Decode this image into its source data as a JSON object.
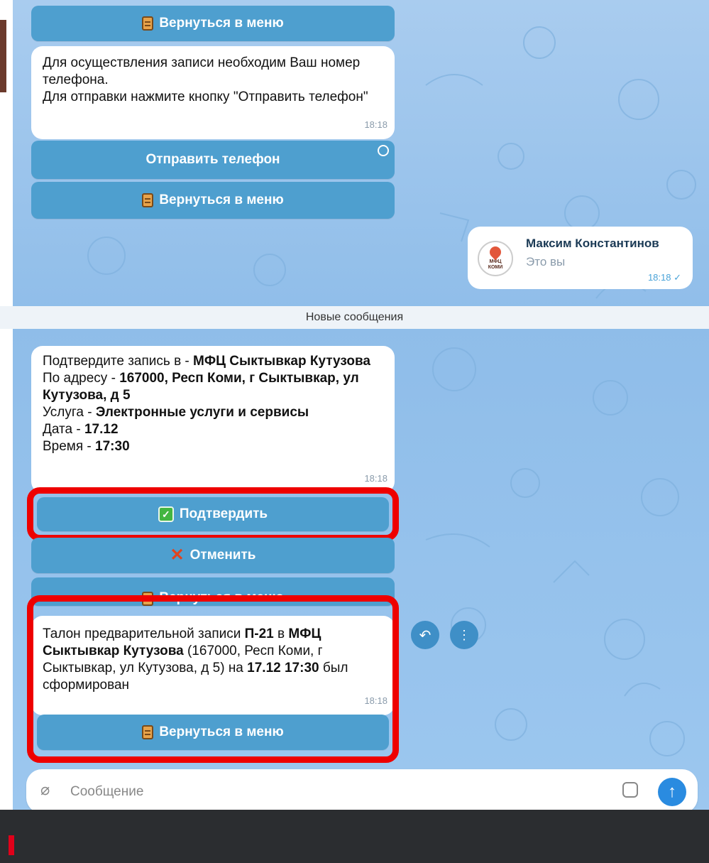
{
  "messages": {
    "phone_request": {
      "text": "Для осуществления записи необходим Ваш номер телефона.\nДля отправки нажмите кнопку \"Отправить телефон\"",
      "time": "18:18"
    },
    "confirm": {
      "intro": "Подтвердите запись в - ",
      "office": "МФЦ Сыктывкар Кутузова",
      "address_label": "По адресу - ",
      "address": "167000, Респ Коми, г Сыктывкар, ул Кутузова, д 5",
      "service_label": "Услуга - ",
      "service": "Электронные услуги и сервисы",
      "date_label": "Дата - ",
      "date": "17.12",
      "time_label": "Время - ",
      "time_value": "17:30",
      "time": "18:18"
    },
    "ticket": {
      "p1": "Талон предварительной записи ",
      "ticket_no": "П-21",
      "p2": " в ",
      "office": "МФЦ Сыктывкар Кутузова",
      "p3": " (167000, Респ Коми, г Сыктывкар, ул Кутузова, д 5) на ",
      "datetime": "17.12 17:30",
      "p4": " был сформирован",
      "time": "18:18"
    }
  },
  "buttons": {
    "back_to_menu": "Вернуться в меню",
    "send_phone": "Отправить телефон",
    "confirm": "Подтвердить",
    "cancel": "Отменить"
  },
  "contact": {
    "name": "Максим Константинов",
    "subtitle": "Это вы",
    "time": "18:18 ✓",
    "avatar_label": "МФЦ КОМИ"
  },
  "separator": "Новые сообщения",
  "composer": {
    "placeholder": "Сообщение"
  },
  "colors": {
    "button": "#4e9fcf",
    "highlight": "#ee0000",
    "send": "#2a8be0"
  }
}
